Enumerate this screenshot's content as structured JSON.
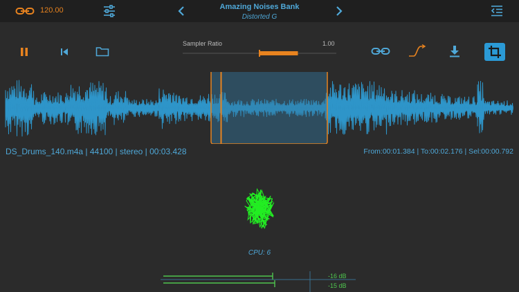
{
  "header": {
    "tempo_value": "120.00",
    "bank_title": "Amazing Noises Bank",
    "preset_name": "Distorted G"
  },
  "transport": {
    "ratio_label": "Sampler Ratio",
    "ratio_value": "1.00",
    "ratio_slider_level": 0.25
  },
  "info": {
    "file": "DS_Drums_140.m4a | 44100 | stereo  | 00:03.428",
    "selection": "From:00:01.384 | To:00:02.176 | Sel:00:00.792"
  },
  "cpu": "CPU: 6",
  "meters": {
    "db_left": "-16 dB",
    "db_right": "-15 dB"
  },
  "colors": {
    "accent_orange": "#e8831f",
    "accent_blue": "#4fa8d8",
    "wave_blue": "#2e95c9",
    "scope_green": "#22ee22",
    "background": "#2b2b2b"
  },
  "icons": [
    "link-icon",
    "mixer-sliders-icon",
    "chevron-left-icon",
    "chevron-right-icon",
    "menu-icon",
    "pause-icon",
    "rewind-icon",
    "folder-icon",
    "curve-icon",
    "download-icon",
    "crop-icon"
  ]
}
